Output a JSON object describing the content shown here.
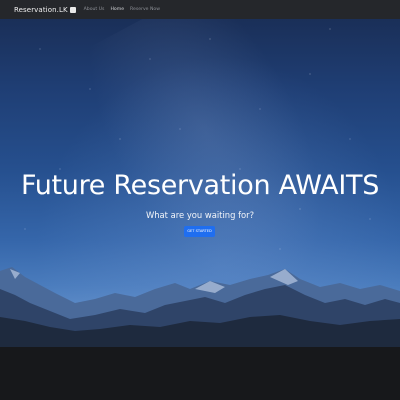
{
  "navbar": {
    "brand": "Reservation.LK",
    "brand_icon": "hotel-icon",
    "links": [
      {
        "label": "About Us",
        "active": false
      },
      {
        "label": "Home",
        "active": true
      },
      {
        "label": "Reserve Now",
        "active": false
      }
    ]
  },
  "hero": {
    "title": "Future Reservation AWAITS",
    "subtitle": "What are you waiting for?",
    "cta_label": "GET STARTED"
  },
  "colors": {
    "navbar_bg": "#25272b",
    "cta_bg": "#1f6ef0",
    "sky_top": "#1a2f58",
    "sky_bottom": "#5b8ac6",
    "ground": "#17181b"
  }
}
